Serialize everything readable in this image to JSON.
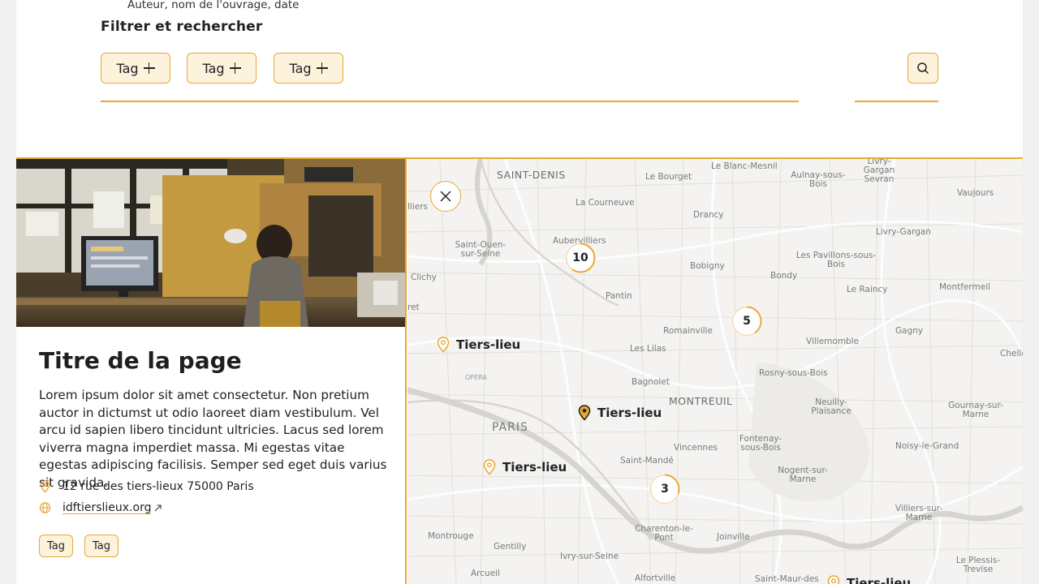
{
  "header": {
    "hint_text": "Auteur, nom de l'ouvrage, date",
    "filter_title": "Filtrer et rechercher",
    "tags": [
      {
        "label": "Tag"
      },
      {
        "label": "Tag"
      },
      {
        "label": "Tag"
      }
    ]
  },
  "card": {
    "title": "Titre de la page",
    "description": "Lorem ipsum dolor sit amet consectetur. Non pretium auctor in dictumst ut odio laoreet diam vestibulum. Vel arcu id sapien libero tincidunt ultricies. Lacus sed lorem viverra magna imperdiet massa. Mi egestas vitae egestas adipiscing facilisis. Semper sed eget duis varius sit gravida.",
    "address": "12 rue des tiers-lieux 75000 Paris",
    "website": "idftierslieux.org",
    "tags": [
      "Tag",
      "Tag"
    ]
  },
  "map": {
    "clusters": [
      {
        "count": "10",
        "fill": 0.6
      },
      {
        "count": "5",
        "fill": 0.4
      },
      {
        "count": "3",
        "fill": 0.3
      }
    ],
    "markers": [
      {
        "label": "Tiers-lieu",
        "active": false
      },
      {
        "label": "Tiers-lieu",
        "active": true
      },
      {
        "label": "Tiers-lieu",
        "active": false
      },
      {
        "label": "Tiers-lieu",
        "active": false
      }
    ],
    "places": [
      "SAINT-DENIS",
      "Le Bourget",
      "Le Blanc-Mesnil",
      "Aulnay-sous-Bois",
      "Livry-Gargan Sevran",
      "Vaujours",
      "lliers",
      "La Courneuve",
      "Drancy",
      "Livry-Gargan",
      "Aubervilliers",
      "Saint-Ouen-sur-Seine",
      "Bobigny",
      "Les Pavillons-sous-Bois",
      "Clichy",
      "Bondy",
      "Le Raincy",
      "Montfermeil",
      "ret",
      "Pantin",
      "Romainville",
      "Gagny",
      "Les Lilas",
      "Villemomble",
      "Chelles Mo",
      "OPÉRA",
      "Bagnolet",
      "Rosny-sous-Bois",
      "MONTREUIL",
      "Neuilly-Plaisance",
      "Gournay-sur-Marne",
      "PARIS",
      "Vincennes",
      "Fontenay-sous-Bois",
      "Noisy-le-Grand",
      "Saint-Mandé",
      "Nogent-sur-Marne",
      "Villiers-sur-Marne",
      "Charenton-le-Pont",
      "Montrouge",
      "Joinville",
      "Gentilly",
      "Ivry-sur-Seine",
      "Le Plessis-Trevise",
      "Arcueil",
      "Alfortville",
      "Saint-Maur-des"
    ]
  },
  "colors": {
    "accent": "#e8a833",
    "tag_bg": "#fdf3dc",
    "map_bg": "#f4f3f1"
  },
  "icons": [
    "plus-icon",
    "search-icon",
    "close-icon",
    "map-pin-icon",
    "globe-icon",
    "external-link-icon"
  ]
}
